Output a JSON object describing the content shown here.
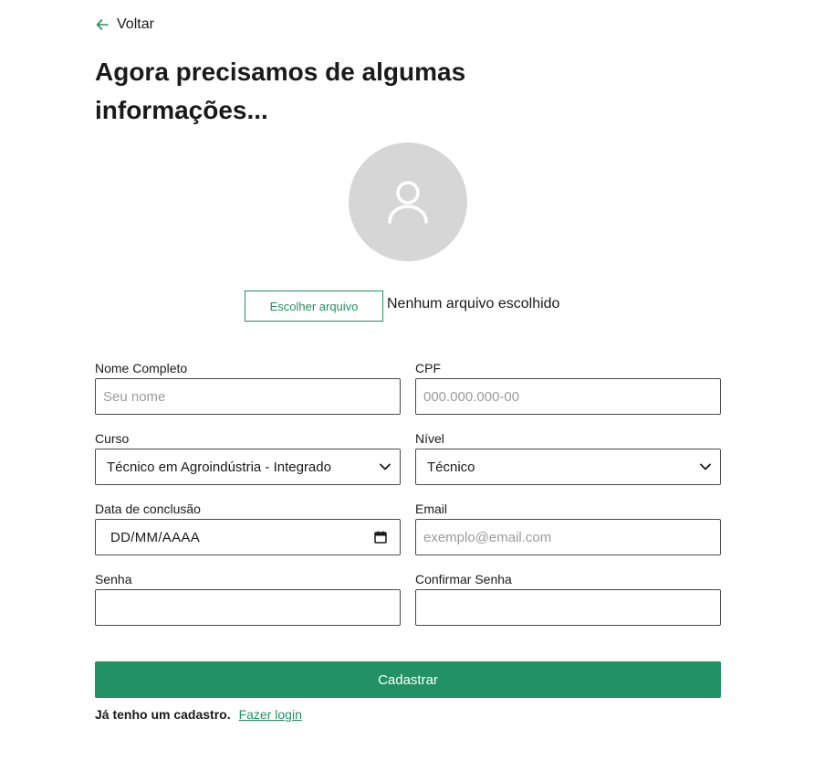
{
  "back": {
    "label": "Voltar",
    "icon": "arrow-left-icon"
  },
  "title": "Agora precisamos de algumas informações...",
  "avatar": {
    "icon": "user-icon"
  },
  "file": {
    "button_label": "Escolher arquivo",
    "status": "Nenhum arquivo escolhido"
  },
  "form": {
    "nome": {
      "label": "Nome Completo",
      "placeholder": "Seu nome"
    },
    "cpf": {
      "label": "CPF",
      "placeholder": "000.000.000-00"
    },
    "curso": {
      "label": "Curso",
      "value": "Técnico em Agroindústria - Integrado"
    },
    "nivel": {
      "label": "Nível",
      "value": "Técnico"
    },
    "data": {
      "label": "Data de conclusão",
      "value": "DD/MM/AAAA",
      "icon": "calendar-icon"
    },
    "email": {
      "label": "Email",
      "placeholder": "exemplo@email.com"
    },
    "senha": {
      "label": "Senha",
      "placeholder": ""
    },
    "confirmar": {
      "label": "Confirmar Senha",
      "placeholder": ""
    }
  },
  "submit_label": "Cadastrar",
  "login": {
    "question": "Já tenho um cadastro.",
    "link": "Fazer login"
  },
  "colors": {
    "accent": "#229163",
    "avatar_bg": "#d6d6d6",
    "border": "#4a4a4a"
  }
}
